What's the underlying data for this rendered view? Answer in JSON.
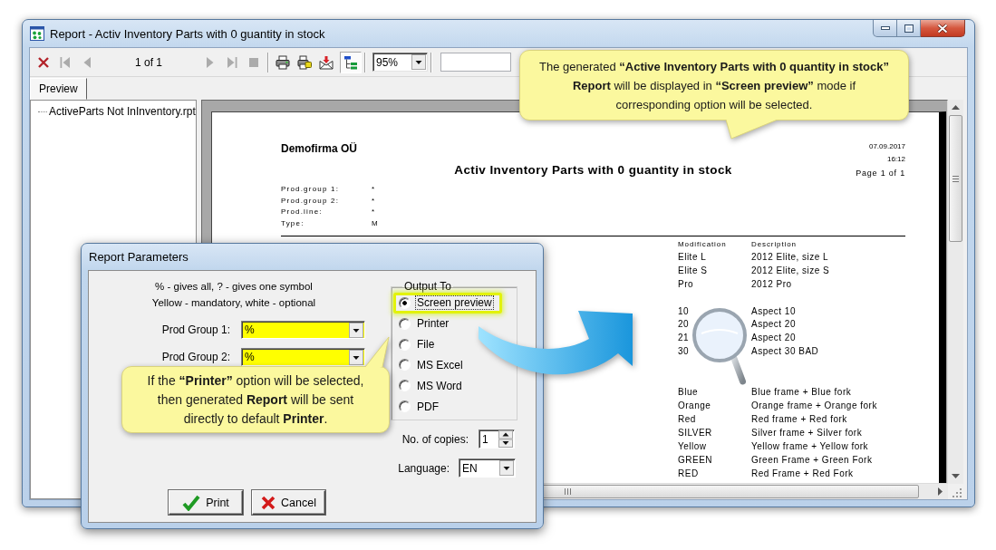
{
  "window": {
    "title": "Report - Activ Inventory Parts with 0 guantity in stock"
  },
  "toolbar": {
    "items": [
      {
        "kind": "close",
        "disabled": false
      },
      {
        "kind": "first",
        "disabled": true
      },
      {
        "kind": "previous",
        "disabled": true
      },
      {
        "kind": "page",
        "text": "1 of 1"
      },
      {
        "kind": "next",
        "disabled": true
      },
      {
        "kind": "last",
        "disabled": true
      },
      {
        "kind": "stop",
        "disabled": true
      },
      {
        "kind": "separator"
      },
      {
        "kind": "print",
        "disabled": false
      },
      {
        "kind": "printer_setup",
        "disabled": false
      },
      {
        "kind": "export",
        "disabled": false
      },
      {
        "kind": "group_tree",
        "disabled": false,
        "pressed": true
      },
      {
        "kind": "separator"
      },
      {
        "kind": "zoom",
        "value": "95%"
      },
      {
        "kind": "separator"
      },
      {
        "kind": "search_field"
      }
    ]
  },
  "tabs": [
    {
      "label": "Preview",
      "selected": true
    }
  ],
  "tree": {
    "items": [
      {
        "label": "ActiveParts Not InInventory.rpt"
      }
    ]
  },
  "report": {
    "company": "Demofirma OÜ",
    "date": "07.09.2017",
    "time": "16:12",
    "page": "Page 1 of 1",
    "title": "Activ Inventory Parts with 0 guantity in stock",
    "parameters": [
      {
        "label": "Prod.group 1:",
        "value": "*"
      },
      {
        "label": "Prod.group 2:",
        "value": "*"
      },
      {
        "label": "Prod.line:",
        "value": "*"
      },
      {
        "label": "Type:",
        "value": "M"
      }
    ],
    "columns": [
      "Modification",
      "Description"
    ],
    "groups": [
      {
        "rows": [
          [
            "Elite L",
            "2012 Elite, size L"
          ],
          [
            "Elite S",
            "2012 Elite, size S"
          ],
          [
            "Pro",
            "2012 Pro"
          ]
        ]
      },
      {
        "rows": [
          [
            "10",
            "Aspect 10"
          ],
          [
            "20",
            "Aspect 20"
          ],
          [
            "21",
            "Aspect 20"
          ],
          [
            "30",
            "Aspect 30 BAD"
          ]
        ]
      },
      {
        "rows": [
          [
            "Blue",
            "Blue frame + Blue fork"
          ],
          [
            "Orange",
            "Orange frame + Orange fork"
          ],
          [
            "Red",
            "Red frame + Red fork"
          ],
          [
            "SILVER",
            "Silver frame + Silver fork"
          ],
          [
            "Yellow",
            "Yellow frame + Yellow fork"
          ],
          [
            "GREEN",
            "Green Frame + Green Fork"
          ],
          [
            "RED",
            "Red Frame + Red Fork"
          ]
        ]
      }
    ]
  },
  "dialog": {
    "title": "Report Parameters",
    "hints": [
      "% - gives all, ? - gives one symbol",
      "Yellow - mandatory, white - optional"
    ],
    "fields": [
      {
        "label": "Prod Group 1:",
        "value": "%",
        "mandatory": true
      },
      {
        "label": "Prod Group 2:",
        "value": "%",
        "mandatory": true
      }
    ],
    "output": {
      "title": "Output To",
      "options": [
        {
          "label": "Screen preview",
          "selected": true,
          "focused": true,
          "highlighted": true
        },
        {
          "label": "Printer",
          "selected": false,
          "focused": false,
          "highlighted": false
        },
        {
          "label": "File",
          "selected": false,
          "focused": false,
          "highlighted": false
        },
        {
          "label": "MS Excel",
          "selected": false,
          "focused": false,
          "highlighted": false
        },
        {
          "label": "MS Word",
          "selected": false,
          "focused": false,
          "highlighted": false
        },
        {
          "label": "PDF",
          "selected": false,
          "focused": false,
          "highlighted": false
        }
      ]
    },
    "copies": {
      "label": "No. of copies:",
      "value": "1"
    },
    "language": {
      "label": "Language:",
      "value": "EN"
    },
    "buttons": [
      {
        "kind": "print",
        "label": "Print"
      },
      {
        "kind": "cancel",
        "label": "Cancel"
      }
    ]
  },
  "callouts": [
    {
      "text": "The generated **“Active Inventory Parts with 0 quantity in stock” Report** will be displayed in **“Screen preview”** mode if corresponding option will be selected."
    },
    {
      "text": "If the **“Printer”** option will be selected, then generated **Report** will be sent directly to default **Printer**."
    }
  ]
}
